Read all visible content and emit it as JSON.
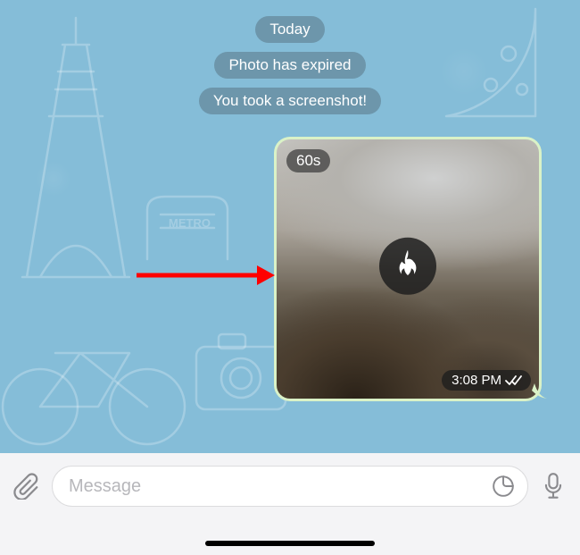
{
  "date_label": "Today",
  "system_messages": [
    "Photo has expired",
    "You took a screenshot!"
  ],
  "photo": {
    "timer_label": "60s",
    "timestamp": "3:08 PM",
    "read_status": "read"
  },
  "input": {
    "placeholder": "Message"
  },
  "colors": {
    "chat_bg": "#85bdd8",
    "pill_bg": "rgba(105,143,163,0.85)",
    "bubble_out": "#daf2c7",
    "arrow": "#ff0000"
  },
  "icons": {
    "attach": "paperclip",
    "sticker": "sticker-outline",
    "mic": "microphone",
    "fire": "fire",
    "checks": "double-check"
  }
}
